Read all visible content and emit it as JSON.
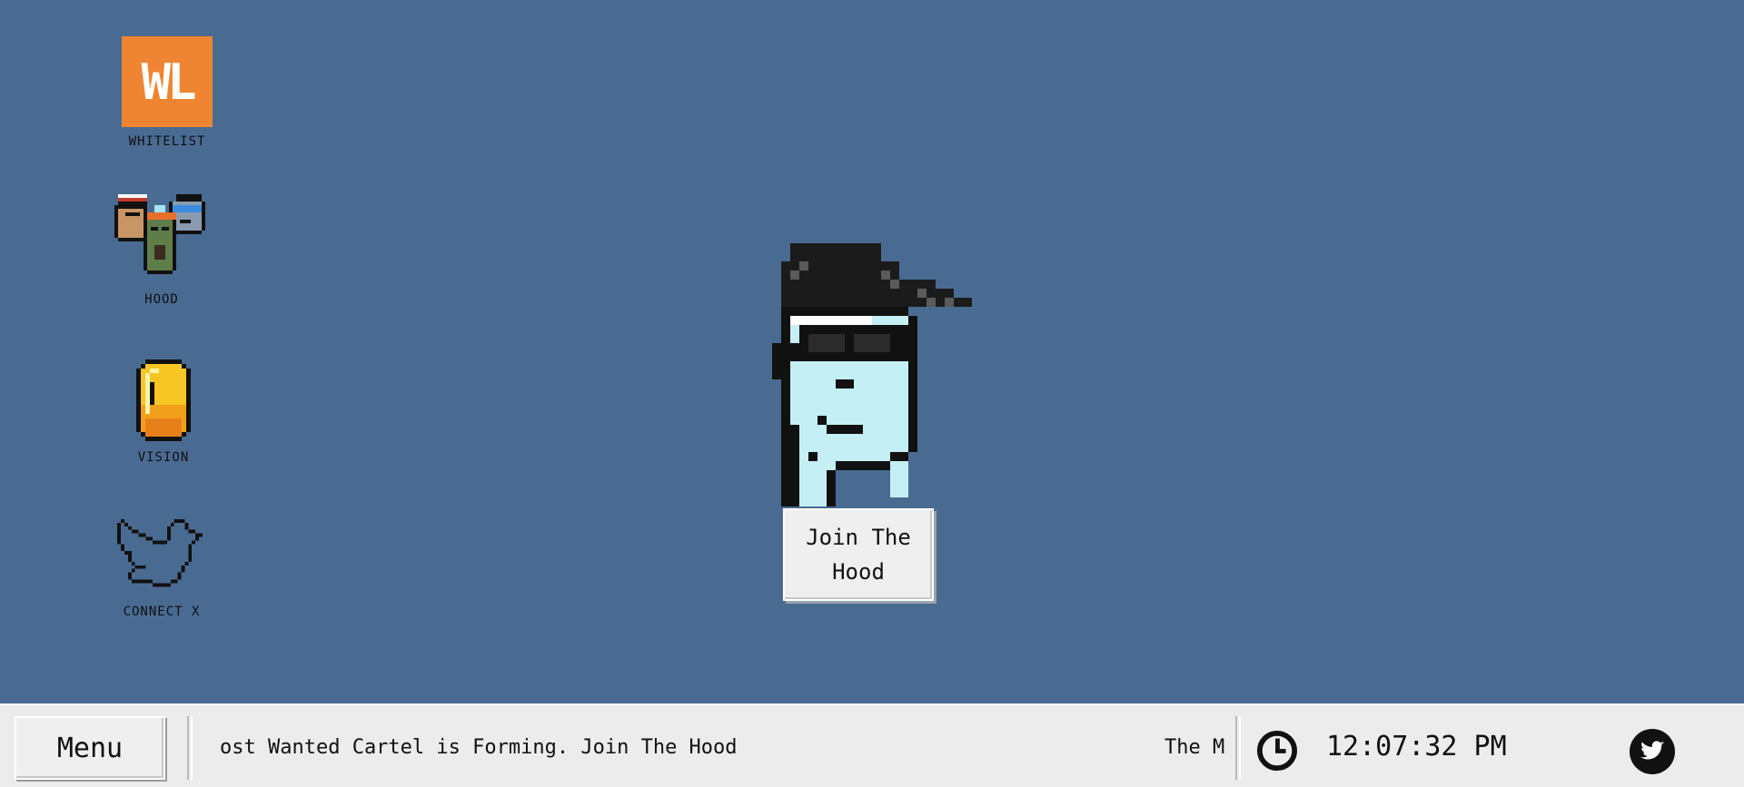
{
  "desktop": {
    "background_color": "#4a6b91",
    "icons": [
      {
        "id": "whitelist",
        "label": "WHITELIST",
        "icon": "wl-logo-icon",
        "logo_text": "WL",
        "color": "#ef8532"
      },
      {
        "id": "hood",
        "label": "HOOD",
        "icon": "pixel-characters-group-icon"
      },
      {
        "id": "vision",
        "label": "VISION",
        "icon": "gold-coin-icon"
      },
      {
        "id": "connect",
        "label": "CONNECT X",
        "icon": "bird-outline-icon"
      }
    ]
  },
  "hero": {
    "image": "pixel-punk-character-icon",
    "cta_label": "Join The Hood"
  },
  "taskbar": {
    "menu_label": "Menu",
    "ticker_visible_text": "ost Wanted Cartel is Forming. Join The Hood",
    "ticker_tail_text": "The M",
    "clock_icon": "clock-icon",
    "time": "12:07:32 PM",
    "twitter_icon": "twitter-bird-icon"
  }
}
